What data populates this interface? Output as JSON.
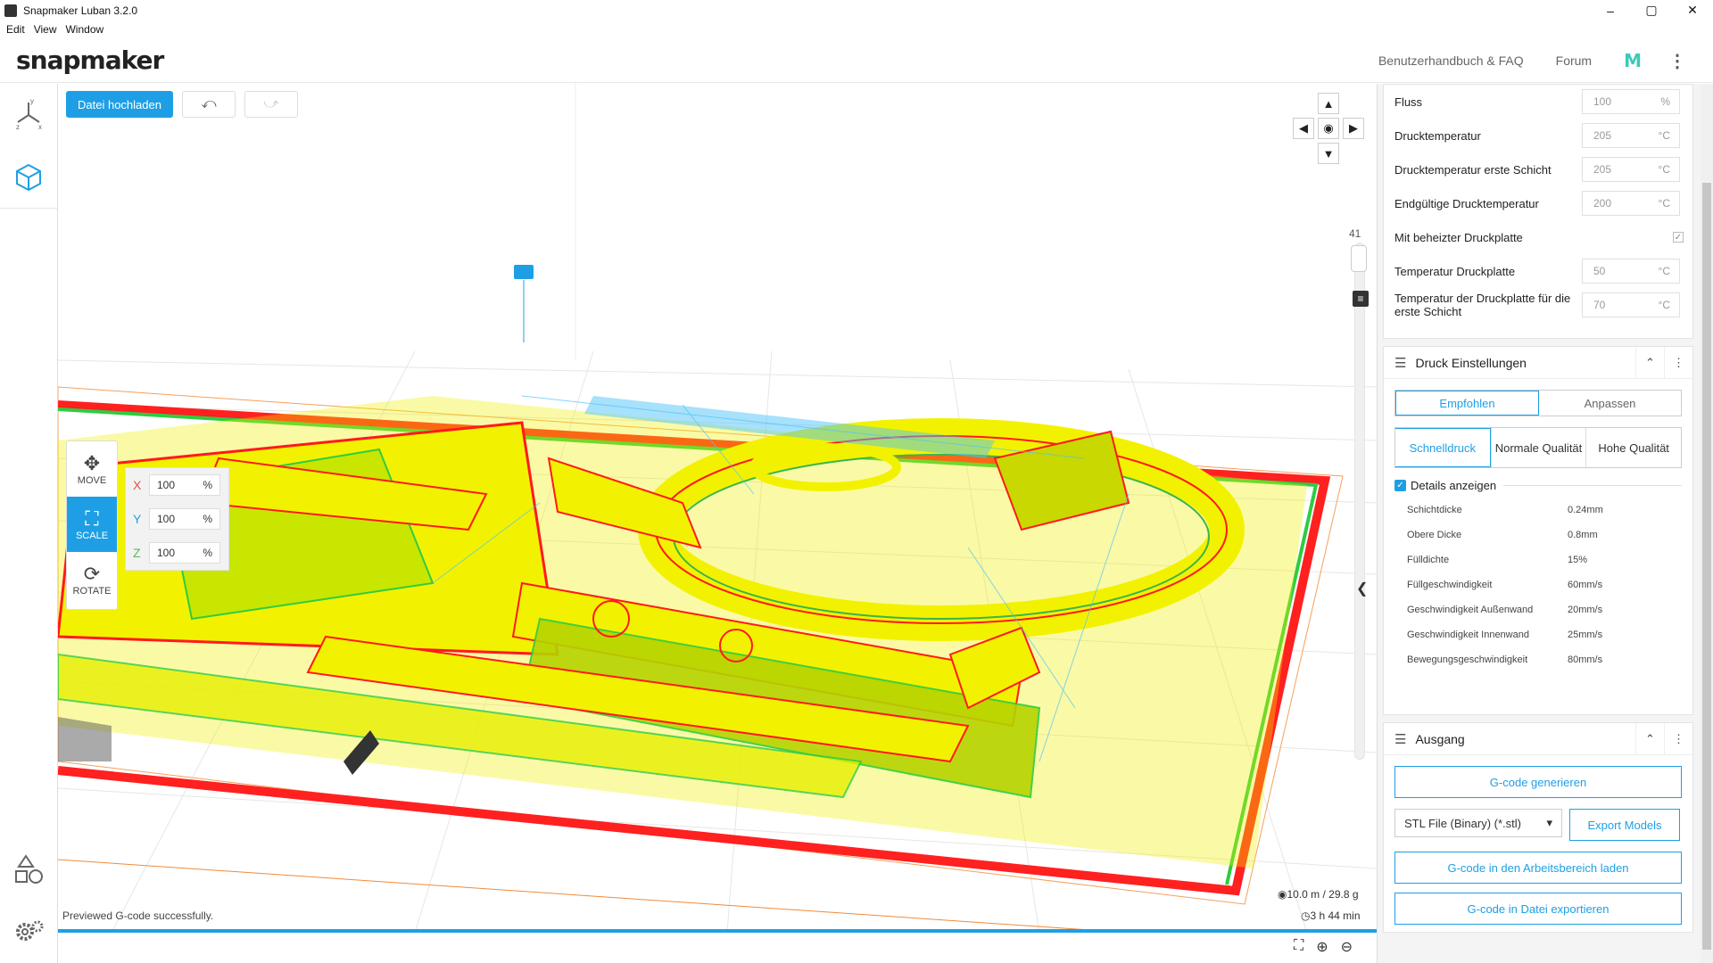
{
  "window": {
    "title": "Snapmaker Luban 3.2.0",
    "controls": [
      "–",
      "▢",
      "✕"
    ]
  },
  "menu": [
    "Edit",
    "View",
    "Window"
  ],
  "header": {
    "logo": "snapmaker",
    "manual_link": "Benutzerhandbuch & FAQ",
    "forum_link": "Forum",
    "m_icon": "M"
  },
  "toolbar": {
    "upload_label": "Datei hochladen",
    "undo_icon": "undo-icon",
    "redo_icon": "redo-icon"
  },
  "transform_tools": [
    {
      "label": "MOVE",
      "active": false
    },
    {
      "label": "SCALE",
      "active": true
    },
    {
      "label": "ROTATE",
      "active": false
    }
  ],
  "scale": {
    "rows": [
      {
        "axis": "X",
        "value": "100",
        "unit": "%",
        "color": "#e0533b"
      },
      {
        "axis": "Y",
        "value": "100",
        "unit": "%",
        "color": "#1e9fe5"
      },
      {
        "axis": "Z",
        "value": "100",
        "unit": "%",
        "color": "#5cb85c"
      }
    ]
  },
  "layer": {
    "count": "41"
  },
  "status": {
    "message": "Previewed G-code successfully.",
    "filament": "10.0 m / 29.8 g",
    "time": "3 h 44 min"
  },
  "material_settings": [
    {
      "label": "Fluss",
      "value": "100",
      "unit": "%"
    },
    {
      "label": "Drucktemperatur",
      "value": "205",
      "unit": "°C"
    },
    {
      "label": "Drucktemperatur erste Schicht",
      "value": "205",
      "unit": "°C"
    },
    {
      "label": "Endgültige Drucktemperatur",
      "value": "200",
      "unit": "°C"
    },
    {
      "label": "Mit beheizter Druckplatte",
      "checked": true
    },
    {
      "label": "Temperatur Druckplatte",
      "value": "50",
      "unit": "°C"
    },
    {
      "label": "Temperatur der Druckplatte für die erste Schicht",
      "value": "70",
      "unit": "°C"
    }
  ],
  "print_settings": {
    "title": "Druck Einstellungen",
    "mode_tabs": [
      "Empfohlen",
      "Anpassen"
    ],
    "quality_tabs": [
      "Schnelldruck",
      "Normale Qualität",
      "Hohe Qualität"
    ],
    "details_label": "Details anzeigen",
    "details": [
      {
        "k": "Schichtdicke",
        "v": "0.24mm"
      },
      {
        "k": "Obere Dicke",
        "v": "0.8mm"
      },
      {
        "k": "Fülldichte",
        "v": "15%"
      },
      {
        "k": "Füllgeschwindigkeit",
        "v": "60mm/s"
      },
      {
        "k": "Geschwindigkeit Außenwand",
        "v": "20mm/s"
      },
      {
        "k": "Geschwindigkeit Innenwand",
        "v": "25mm/s"
      },
      {
        "k": "Bewegungsgeschwindigkeit",
        "v": "80mm/s"
      }
    ]
  },
  "output": {
    "title": "Ausgang",
    "generate_label": "G-code generieren",
    "format_select": "STL File (Binary) (*.stl)",
    "export_models_label": "Export Models",
    "load_workspace_label": "G-code in den Arbeitsbereich laden",
    "export_file_label": "G-code in Datei exportieren"
  },
  "colors": {
    "accent": "#1e9fe5",
    "toolpath_yellow": "#f2f200",
    "toolpath_red": "#ff1a1a",
    "toolpath_green": "#2ecc40",
    "toolpath_cyan": "#4fc3f7"
  }
}
